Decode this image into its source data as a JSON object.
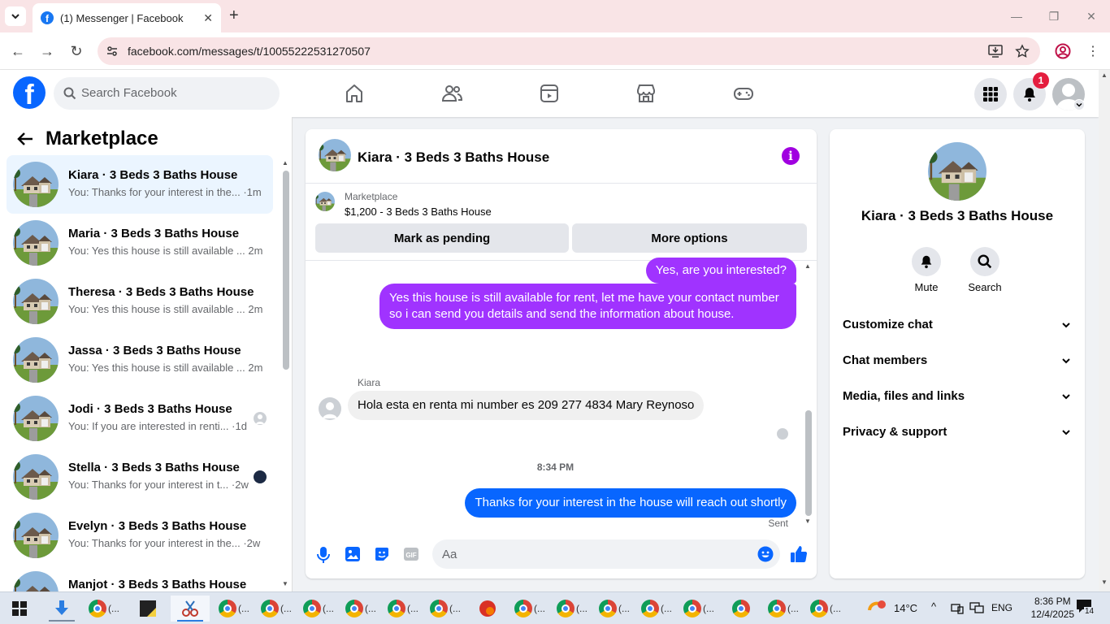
{
  "browser": {
    "tab_title": "(1) Messenger | Facebook",
    "url": "facebook.com/messages/t/10055222531270507"
  },
  "fb": {
    "search_placeholder": "Search Facebook",
    "notification_count": "1"
  },
  "left": {
    "title": "Marketplace",
    "conversations": [
      {
        "name": "Kiara · 3 Beds 3 Baths House",
        "preview": "You: Thanks for your interest in the... ·1m",
        "active": true
      },
      {
        "name": "Maria · 3 Beds 3 Baths House",
        "preview": "You: Yes this house is still available ... 2m"
      },
      {
        "name": "Theresa · 3 Beds 3 Baths House",
        "preview": "You: Yes this house is still available ... 2m"
      },
      {
        "name": "Jassa · 3 Beds 3 Baths House",
        "preview": "You: Yes this house is still available ... 2m"
      },
      {
        "name": "Jodi · 3 Beds 3 Baths House",
        "preview": "You: If you are interested in renti... ·1d"
      },
      {
        "name": "Stella · 3 Beds 3 Baths House",
        "preview": "You: Thanks for your interest in t... ·2w"
      },
      {
        "name": "Evelyn · 3 Beds 3 Baths House",
        "preview": "You: Thanks for your interest in the... ·2w"
      },
      {
        "name": "Manjot · 3 Beds 3 Baths House",
        "preview": ""
      }
    ]
  },
  "chat": {
    "title": "Kiara · 3 Beds 3 Baths House",
    "marketplace_label": "Marketplace",
    "listing": "$1,200 - 3 Beds 3 Baths House",
    "mark_pending": "Mark as pending",
    "more_options": "More options",
    "messages": {
      "m1": "Yes, are you interested?",
      "m2_line1": "Yes this house is still available for rent, let me have your contact number",
      "m2_line2": "so i can send you details and send the information about house.",
      "sender": "Kiara",
      "m3": "Hola esta en renta mi number es 209 277 4834 Mary Reynoso",
      "time": "8:34 PM",
      "m4": "Thanks for your interest in the house will reach out shortly",
      "status": "Sent"
    },
    "composer_placeholder": "Aa"
  },
  "info": {
    "name": "Kiara · 3 Beds 3 Baths House",
    "mute": "Mute",
    "search": "Search",
    "sections": [
      "Customize chat",
      "Chat members",
      "Media, files and links",
      "Privacy & support"
    ]
  },
  "taskbar": {
    "weather": "14°C",
    "lang": "ENG",
    "time": "8:36 PM",
    "date": "12/4/2025",
    "notif_count": "14"
  },
  "colors": {
    "brand": "#0866ff",
    "outgoing": "#a033ff",
    "accent": "#a000e0"
  }
}
